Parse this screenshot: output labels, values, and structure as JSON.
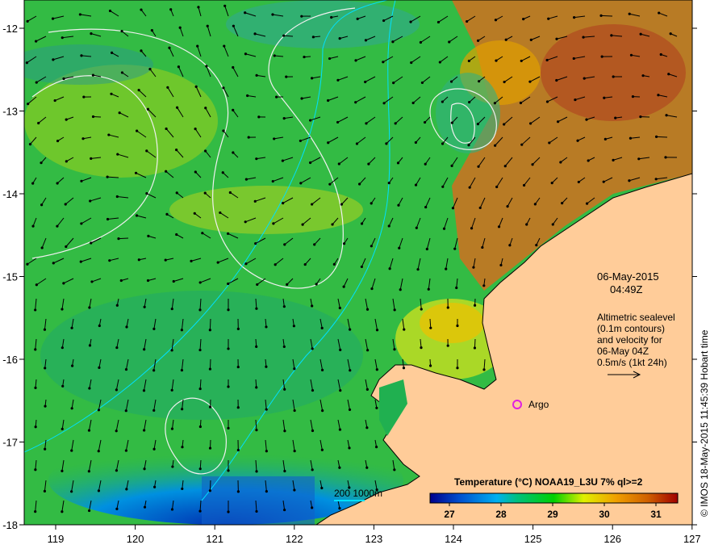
{
  "map": {
    "lon_ticks": [
      "119",
      "120",
      "121",
      "122",
      "123",
      "124",
      "125",
      "126",
      "127"
    ],
    "lat_ticks": [
      "-12",
      "-13",
      "-14",
      "-15",
      "-16",
      "-17",
      "-18"
    ],
    "date": "06-May-2015",
    "time": "04:49Z",
    "legend_lines": [
      "Altimetric sealevel",
      "(0.1m contours)",
      "and velocity for",
      "06-May 04Z",
      "0.5m/s (1kt 24h)"
    ],
    "argo_label": "Argo",
    "scale_label": "200  1000m",
    "credit": "© IMOS 18-May-2015 11:45:39 Hobart time",
    "colorbar": {
      "title": "Temperature (°C) NOAA19_L3U 7% ql>=2",
      "ticks": [
        "27",
        "28",
        "29",
        "30",
        "31"
      ],
      "range": [
        26.6,
        31.4
      ],
      "colors": [
        "#00008b",
        "#0050d0",
        "#00b0f0",
        "#00c080",
        "#00d000",
        "#e0f000",
        "#f0a000",
        "#d06000",
        "#a00000"
      ]
    },
    "land_color": "#ffcc99",
    "argo_color": "#e020e0"
  }
}
